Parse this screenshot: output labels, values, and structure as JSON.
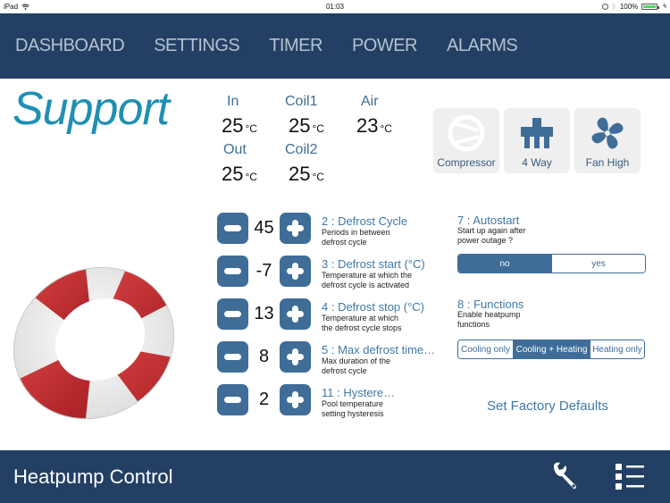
{
  "status_bar": {
    "device": "iPad",
    "time": "01:03",
    "battery": "100%"
  },
  "nav": {
    "items": [
      {
        "label": "DASHBOARD"
      },
      {
        "label": "SETTINGS"
      },
      {
        "label": "TIMER"
      },
      {
        "label": "POWER"
      },
      {
        "label": "ALARMS"
      }
    ]
  },
  "page": {
    "title": "Support"
  },
  "sensors": {
    "unit": "°C",
    "in": {
      "label": "In",
      "value": "25"
    },
    "coil1": {
      "label": "Coil1",
      "value": "25"
    },
    "air": {
      "label": "Air",
      "value": "23"
    },
    "out": {
      "label": "Out",
      "value": "25"
    },
    "coil2": {
      "label": "Coil2",
      "value": "25"
    }
  },
  "tiles": {
    "compressor": {
      "label": "Compressor",
      "icon": "compressor-icon",
      "active": false
    },
    "four_way": {
      "label": "4 Way",
      "icon": "four-way-valve-icon",
      "active": true
    },
    "fan": {
      "label": "Fan High",
      "icon": "fan-icon",
      "active": true
    }
  },
  "params": [
    {
      "title": "2 : Defrost Cycle",
      "desc": "Periods in between defrost cycle",
      "value": "45"
    },
    {
      "title": "3 : Defrost start (°C)",
      "desc": "Temperature at which the defrost cycle is activated",
      "value": "-7"
    },
    {
      "title": "4 : Defrost stop (°C)",
      "desc": "Temperature at which the defrost cycle stops",
      "value": "13"
    },
    {
      "title": "5 : Max defrost time…",
      "desc": "Max duration of the defrost cycle",
      "value": "8"
    },
    {
      "title": "11 : Hystere…",
      "desc": "Pool temperature setting hysteresis",
      "value": "2"
    }
  ],
  "autostart": {
    "title": "7 : Autostart",
    "desc": "Start up again after power outage ?",
    "options": [
      "no",
      "yes"
    ],
    "selected": "no"
  },
  "functions": {
    "title": "8 : Functions",
    "desc": "Enable heatpump functions",
    "options": [
      "Cooling only",
      "Cooling + Heating",
      "Heating only"
    ],
    "selected": "Cooling + Heating"
  },
  "factory_defaults_label": "Set Factory Defaults",
  "bottom_bar": {
    "title": "Heatpump Control"
  },
  "colors": {
    "nav_bg": "#234064",
    "accent": "#3f6d98",
    "title": "#1f8fb3"
  }
}
